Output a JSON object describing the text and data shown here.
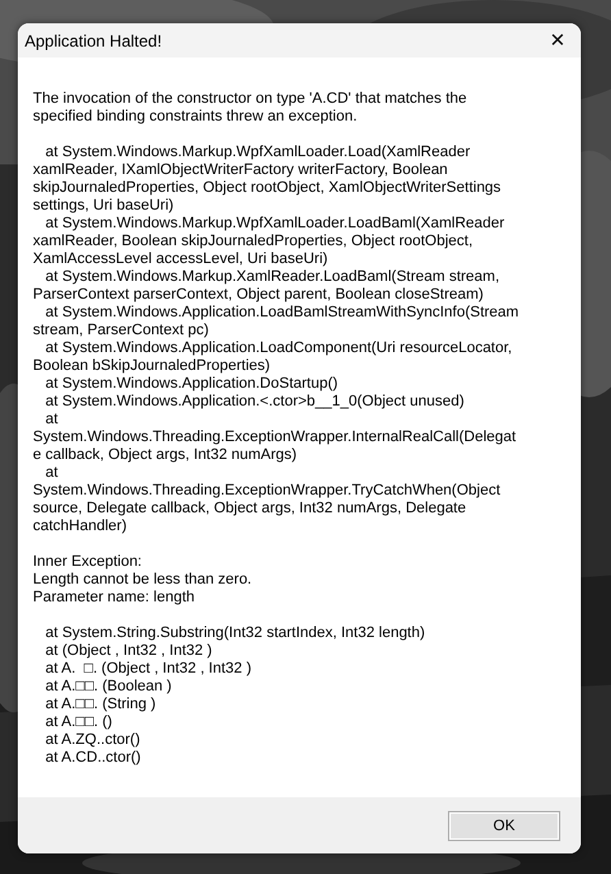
{
  "window": {
    "title": "Application Halted!",
    "close": "✕"
  },
  "message_blocks": [
    {
      "lines": [
        "The invocation of the constructor on type 'A.CD' that matches the",
        "specified binding constraints threw an exception."
      ]
    },
    {
      "lines": [
        "   at System.Windows.Markup.WpfXamlLoader.Load(XamlReader",
        "xamlReader, IXamlObjectWriterFactory writerFactory, Boolean",
        "skipJournaledProperties, Object rootObject, XamlObjectWriterSettings",
        "settings, Uri baseUri)",
        "   at System.Windows.Markup.WpfXamlLoader.LoadBaml(XamlReader",
        "xamlReader, Boolean skipJournaledProperties, Object rootObject,",
        "XamlAccessLevel accessLevel, Uri baseUri)",
        "   at System.Windows.Markup.XamlReader.LoadBaml(Stream stream,",
        "ParserContext parserContext, Object parent, Boolean closeStream)",
        "   at System.Windows.Application.LoadBamlStreamWithSyncInfo(Stream",
        "stream, ParserContext pc)",
        "   at System.Windows.Application.LoadComponent(Uri resourceLocator,",
        "Boolean bSkipJournaledProperties)",
        "   at System.Windows.Application.DoStartup()",
        "   at System.Windows.Application.<.ctor>b__1_0(Object unused)",
        "   at",
        "System.Windows.Threading.ExceptionWrapper.InternalRealCall(Delegat",
        "e callback, Object args, Int32 numArgs)",
        "   at",
        "System.Windows.Threading.ExceptionWrapper.TryCatchWhen(Object",
        "source, Delegate callback, Object args, Int32 numArgs, Delegate",
        "catchHandler)"
      ]
    },
    {
      "lines": [
        "Inner Exception:",
        "Length cannot be less than zero.",
        "Parameter name: length"
      ]
    },
    {
      "lines": [
        "   at System.String.Substring(Int32 startIndex, Int32 length)",
        "   at (Object , Int32 , Int32 )",
        "   at A.  □. (Object , Int32 , Int32 )",
        "   at A.□□. (Boolean )",
        "   at A.□□. (String )",
        "   at A.□□. ()",
        "   at A.ZQ..ctor()",
        "   at A.CD..ctor()"
      ]
    }
  ],
  "buttons": [
    {
      "label": "OK"
    }
  ]
}
